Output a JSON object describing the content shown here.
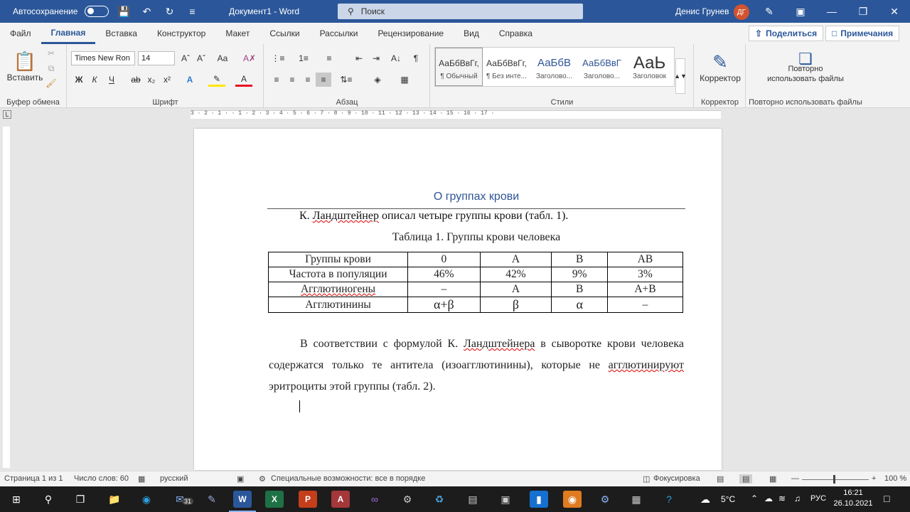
{
  "titlebar": {
    "autosave_label": "Автосохранение",
    "doc_title": "Документ1  -  Word",
    "search_placeholder": "Поиск",
    "user_name": "Денис Грунев",
    "user_initials": "ДГ"
  },
  "menu": {
    "tabs": [
      "Файл",
      "Главная",
      "Вставка",
      "Конструктор",
      "Макет",
      "Ссылки",
      "Рассылки",
      "Рецензирование",
      "Вид",
      "Справка"
    ],
    "active_tab": "Главная",
    "share": "Поделиться",
    "notes": "Примечания"
  },
  "ribbon": {
    "clipboard": {
      "paste": "Вставить",
      "label": "Буфер обмена"
    },
    "font": {
      "family": "Times New Ron",
      "size": "14",
      "label": "Шрифт"
    },
    "paragraph": {
      "label": "Абзац"
    },
    "styles": {
      "label": "Стили",
      "items": [
        {
          "sample": "АаБбВвГг,",
          "name": "¶ Обычный"
        },
        {
          "sample": "АаБбВвГг,",
          "name": "¶ Без инте..."
        },
        {
          "sample": "АаБбВ",
          "name": "Заголово..."
        },
        {
          "sample": "АаБбВвГ",
          "name": "Заголово..."
        },
        {
          "sample": "АаЬ",
          "name": "Заголовок"
        }
      ]
    },
    "editor": {
      "button": "Корректор",
      "label": "Корректор"
    },
    "reuse": {
      "button_line1": "Повторно",
      "button_line2": "использовать файлы",
      "label": "Повторно использовать файлы"
    }
  },
  "ruler": {
    "text": "3 · 2 · 1 ·  · 1 · 2 · 3 · 4 · 5 · 6 · 7 · 8 · 9 · 10 · 11 · 12 · 13 · 14 · 15 · 16 · 17 ·"
  },
  "document": {
    "heading": "О группах крови",
    "intro_pre": "К. ",
    "intro_name": "Ландштейнер",
    "intro_post": " описал четыре группы крови (табл. 1).",
    "caption": "Таблица 1. Группы крови человека",
    "table": [
      [
        "Группы крови",
        "0",
        "A",
        "B",
        "AB"
      ],
      [
        "Частота в популяции",
        "46%",
        "42%",
        "9%",
        "3%"
      ],
      [
        "Агглютиногены",
        "–",
        "A",
        "B",
        "A+B"
      ],
      [
        "Агглютинины",
        "α+β",
        "β",
        "α",
        "–"
      ]
    ],
    "body_1": "В соответствии с формулой К. ",
    "body_name": "Ландштейнера",
    "body_2": " в сыворотке крови человека содержатся только те антитела (изоагглютинины), которые не ",
    "body_word": "агглютинируют",
    "body_3": " эритроциты этой группы (табл. 2)."
  },
  "status": {
    "page": "Страница 1 из 1",
    "words": "Число слов: 60",
    "language": "русский",
    "accessibility": "Специальные возможности: все в порядке",
    "focus": "Фокусировка",
    "zoom": "100 %"
  },
  "taskbar": {
    "weather": "5°C",
    "lang": "РУС",
    "time": "16:21",
    "date": "26.10.2021",
    "calendar_badge": "31"
  }
}
